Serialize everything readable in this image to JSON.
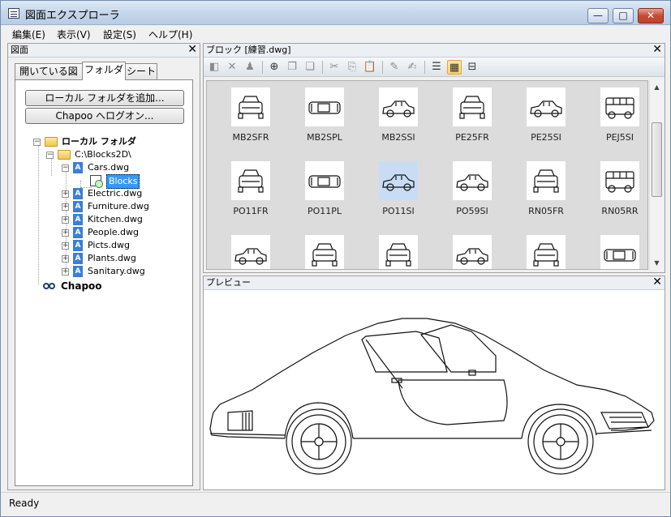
{
  "window": {
    "title": "図面エクスプローラ"
  },
  "caption": {
    "min": "—",
    "max": "□",
    "close": "✕"
  },
  "menu": [
    "編集(E)",
    "表示(V)",
    "設定(S)",
    "ヘルプ(H)"
  ],
  "left_panel": {
    "title": "図面",
    "close": "✕",
    "tabs": [
      "開いている図面",
      "フォルダ",
      "シート"
    ],
    "active_tab": "フォルダ",
    "add_local_folder_button": "ローカル フォルダを追加...",
    "chapoo_logon_button": "Chapoo へログオン...",
    "tree": {
      "local_folder": "ローカル フォルダ",
      "path": "C:\\Blocks2D\\",
      "files": [
        "Cars.dwg",
        "Electric.dwg",
        "Furniture.dwg",
        "Kitchen.dwg",
        "People.dwg",
        "Picts.dwg",
        "Plants.dwg",
        "Sanitary.dwg"
      ],
      "blocks_node": "Blocks",
      "chapoo": "Chapoo"
    }
  },
  "block_panel": {
    "title": "ブロック [練習.dwg]",
    "close": "✕",
    "items": [
      {
        "name": "MB2SFR",
        "view": "front"
      },
      {
        "name": "MB2SPL",
        "view": "top"
      },
      {
        "name": "MB2SSI",
        "view": "side"
      },
      {
        "name": "PE25FR",
        "view": "front"
      },
      {
        "name": "PE25SI",
        "view": "side"
      },
      {
        "name": "PEJ5SI",
        "view": "van"
      },
      {
        "name": "PO11FR",
        "view": "front"
      },
      {
        "name": "PO11PL",
        "view": "top"
      },
      {
        "name": "PO11SI",
        "view": "side",
        "selected": true
      },
      {
        "name": "PO59SI",
        "view": "side"
      },
      {
        "name": "RN05FR",
        "view": "front"
      },
      {
        "name": "RN05RR",
        "view": "van"
      },
      {
        "name": "",
        "view": "side"
      },
      {
        "name": "",
        "view": "front"
      },
      {
        "name": "",
        "view": "front"
      },
      {
        "name": "",
        "view": "side"
      },
      {
        "name": "",
        "view": "front"
      },
      {
        "name": "",
        "view": "top"
      }
    ]
  },
  "preview_panel": {
    "title": "プレビュー",
    "close": "✕"
  },
  "status": {
    "text": "Ready"
  }
}
